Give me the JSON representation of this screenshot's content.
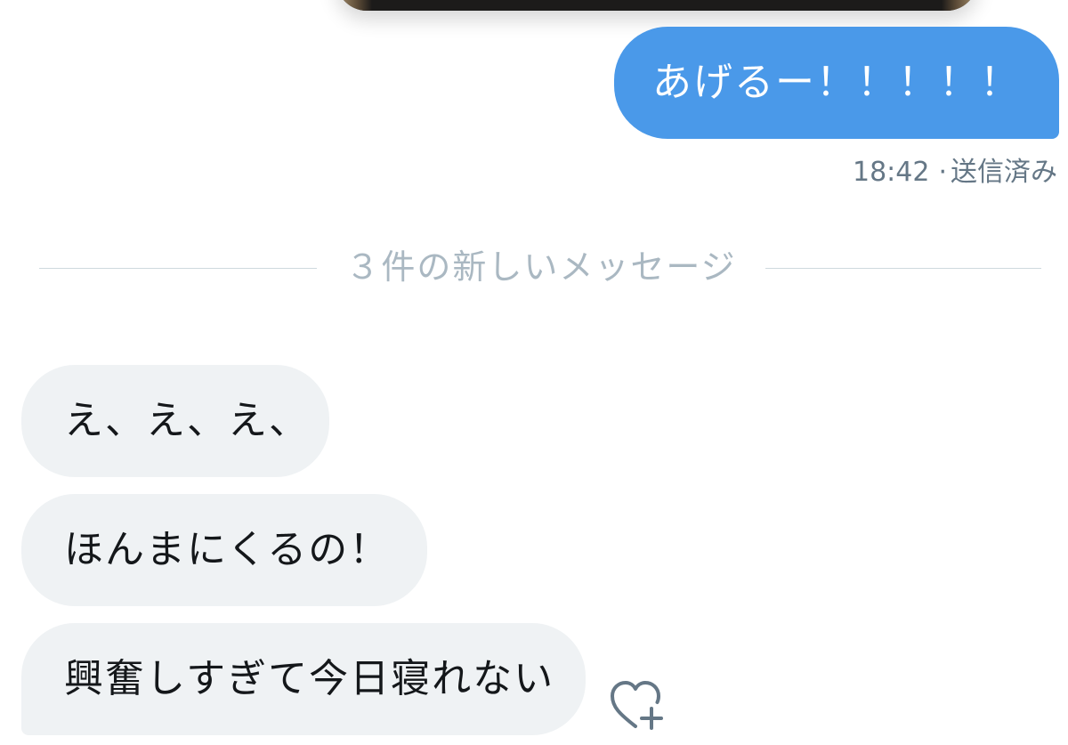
{
  "conversation": {
    "sent": {
      "text": "あげるー！！！！！",
      "time": "18:42",
      "status_separator": "·",
      "status": "送信済み"
    },
    "divider_label": "３件の新しいメッセージ",
    "received": [
      {
        "text": "え、え、え、"
      },
      {
        "text": "ほんまにくるの！"
      },
      {
        "text": "興奮しすぎて今日寝れない"
      }
    ]
  },
  "icons": {
    "reaction": "heart-plus-icon"
  },
  "colors": {
    "sent_bubble": "#4a99e9",
    "received_bubble": "#eff2f4",
    "meta_text": "#657786",
    "divider_text": "#aab8c2"
  }
}
